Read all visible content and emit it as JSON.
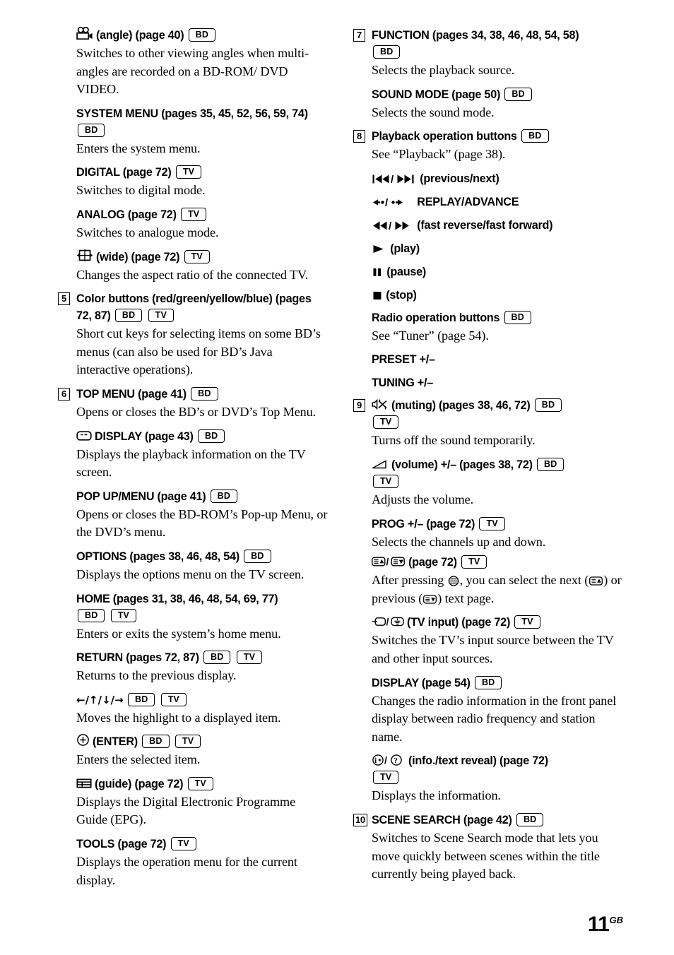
{
  "page": {
    "number": "11",
    "region_code": "GB"
  },
  "badges": {
    "bd": "BD",
    "tv": "TV"
  },
  "left_column": {
    "entries": [
      {
        "marker": "",
        "heading_icon": "movie-camera-icon",
        "heading": "(angle) (page 40)",
        "badges": [
          "BD"
        ],
        "desc": "Switches to other viewing angles when multi-angles are recorded on a BD-ROM/ DVD VIDEO."
      },
      {
        "marker": "",
        "heading": "SYSTEM MENU (pages 35, 45, 52, 56, 59, 74)",
        "badges": [
          "BD"
        ],
        "desc": "Enters the system menu."
      },
      {
        "marker": "",
        "heading": "DIGITAL (page 72)",
        "badges": [
          "TV"
        ],
        "desc": "Switches to digital mode."
      },
      {
        "marker": "",
        "heading": "ANALOG (page 72)",
        "badges": [
          "TV"
        ],
        "desc": "Switches to analogue mode."
      },
      {
        "marker": "",
        "heading_icon": "wide-aspect-icon",
        "heading": "(wide) (page 72)",
        "badges": [
          "TV"
        ],
        "desc": "Changes the aspect ratio of the connected TV."
      },
      {
        "marker": "5",
        "heading": "Color buttons (red/green/yellow/blue) (pages 72, 87)",
        "badges": [
          "BD",
          "TV"
        ],
        "desc": "Short cut keys for selecting items on some BD’s menus (can also be used for BD’s Java interactive operations)."
      },
      {
        "marker": "6",
        "heading": "TOP MENU (page 41)",
        "badges": [
          "BD"
        ],
        "desc": "Opens or closes the BD’s or DVD’s Top Menu."
      },
      {
        "marker": "",
        "heading_icon": "display-screen-icon",
        "heading": "DISPLAY (page 43)",
        "badges": [
          "BD"
        ],
        "desc": "Displays the playback information on the TV screen."
      },
      {
        "marker": "",
        "heading": "POP UP/MENU (page 41)",
        "badges": [
          "BD"
        ],
        "desc": "Opens or closes the BD-ROM’s Pop-up Menu, or the DVD’s menu."
      },
      {
        "marker": "",
        "heading": "OPTIONS (pages 38, 46, 48, 54)",
        "badges": [
          "BD"
        ],
        "desc": "Displays the options menu on the TV screen."
      },
      {
        "marker": "",
        "heading": "HOME (pages 31, 38, 46, 48, 54, 69, 77)",
        "badges": [
          "BD",
          "TV"
        ],
        "desc": "Enters or exits the system’s home menu."
      },
      {
        "marker": "",
        "heading": "RETURN (pages 72, 87)",
        "badges": [
          "BD",
          "TV"
        ],
        "desc": "Returns to the previous display."
      },
      {
        "marker": "",
        "heading_symbols": "←/↑/↓/→",
        "heading": "",
        "badges": [
          "BD",
          "TV"
        ],
        "desc": "Moves the highlight to a displayed item."
      },
      {
        "marker": "",
        "heading_icon": "enter-circle-icon",
        "heading": "(ENTER)",
        "badges": [
          "BD",
          "TV"
        ],
        "desc": "Enters the selected item."
      },
      {
        "marker": "",
        "heading_icon": "guide-grid-icon",
        "heading": "(guide) (page 72)",
        "badges": [
          "TV"
        ],
        "desc": "Displays the Digital Electronic Programme Guide (EPG)."
      },
      {
        "marker": "",
        "heading": "TOOLS (page 72)",
        "badges": [
          "TV"
        ],
        "desc": "Displays the operation menu for the current display."
      }
    ]
  },
  "right_column": {
    "entries": [
      {
        "marker": "7",
        "heading": "FUNCTION (pages 34, 38, 46, 48, 54, 58)",
        "badges": [
          "BD"
        ],
        "desc": "Selects the playback source."
      },
      {
        "marker": "",
        "heading": "SOUND MODE (page 50)",
        "badges": [
          "BD"
        ],
        "desc": "Selects the sound mode."
      },
      {
        "marker": "8",
        "heading": "Playback operation buttons",
        "badges": [
          "BD"
        ],
        "desc": "See “Playback” (page 38)."
      }
    ],
    "playback_buttons": [
      {
        "symbol": "⏮⏮/⏭⏭",
        "label": "(previous/next)",
        "icon": "previous-next-icon"
      },
      {
        "symbol": "←•/•→",
        "label": "REPLAY/ADVANCE",
        "icon": "replay-advance-icon"
      },
      {
        "symbol": "◀◀/▶▶",
        "label": "(fast reverse/fast forward)",
        "icon": "fast-reverse-forward-icon"
      },
      {
        "symbol": "▶",
        "label": "(play)",
        "icon": "play-icon"
      },
      {
        "symbol": "▐▌",
        "label": "(pause)",
        "icon": "pause-icon"
      },
      {
        "symbol": "■",
        "label": "(stop)",
        "icon": "stop-icon"
      }
    ],
    "radio": {
      "heading": "Radio operation buttons",
      "badges": [
        "BD"
      ],
      "desc": "See “Tuner” (page 54).",
      "items": [
        "PRESET +/–",
        "TUNING +/–"
      ]
    },
    "entries2": [
      {
        "marker": "9",
        "heading_icon": "muting-icon",
        "heading": "(muting) (pages 38, 46, 72)",
        "badges": [
          "BD",
          "TV"
        ],
        "desc": "Turns off the sound temporarily."
      },
      {
        "marker": "",
        "heading_icon": "volume-wedge-icon",
        "heading": "(volume) +/– (pages 38, 72)",
        "badges": [
          "BD",
          "TV"
        ],
        "desc": "Adjusts the volume."
      },
      {
        "marker": "",
        "heading": "PROG +/– (page 72)",
        "badges": [
          "TV"
        ],
        "desc": "Selects the channels up and down."
      },
      {
        "marker": "",
        "heading_icon": "text-page-updown-icon",
        "heading": "(page 72)",
        "badges": [
          "TV"
        ],
        "desc_rich": true,
        "desc": "After pressing ☰, you can select the next (▲) or previous (▼) text page."
      },
      {
        "marker": "",
        "heading_icon": "tv-input-icon",
        "heading": "(TV input) (page 72)",
        "badges": [
          "TV"
        ],
        "desc": "Switches the TV’s input source between the TV and other input sources."
      },
      {
        "marker": "",
        "heading": "DISPLAY (page 54)",
        "badges": [
          "BD"
        ],
        "desc": "Changes the radio information in the front panel display between radio frequency and station name."
      },
      {
        "marker": "",
        "heading_icon": "info-text-reveal-icon",
        "heading": "(info./text reveal) (page 72)",
        "badges": [
          "TV"
        ],
        "desc": "Displays the information."
      },
      {
        "marker": "10",
        "heading": "SCENE SEARCH (page 42)",
        "badges": [
          "BD"
        ],
        "desc": "Switches to Scene Search mode that lets you move quickly between scenes within the title currently being played back."
      }
    ]
  }
}
